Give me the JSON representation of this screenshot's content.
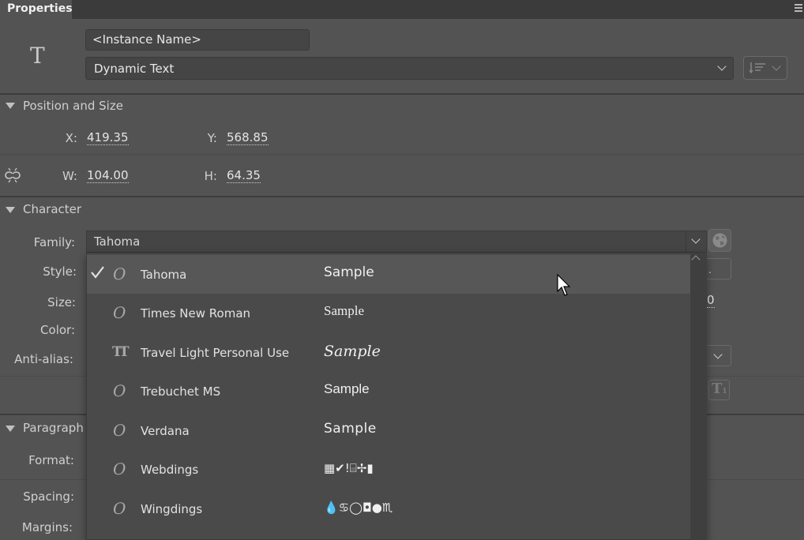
{
  "panel": {
    "tab_label": "Properties",
    "type_icon_glyph": "T",
    "instance_name": "<Instance Name>",
    "text_kind": "Dynamic Text"
  },
  "position_size": {
    "header": "Position and Size",
    "x_label": "X:",
    "x_value": "419.35",
    "y_label": "Y:",
    "y_value": "568.85",
    "w_label": "W:",
    "w_value": "104.00",
    "h_label": "H:",
    "h_value": "64.35"
  },
  "character": {
    "header": "Character",
    "family_label": "Family:",
    "family_value": "Tahoma",
    "style_label": "Style:",
    "size_label": "Size:",
    "size_value_peek": "0",
    "color_label": "Color:",
    "antialias_label": "Anti-alias:",
    "style_value_peek": "."
  },
  "paragraph": {
    "header": "Paragraph",
    "format_label": "Format:",
    "spacing_label": "Spacing:",
    "margins_label": "Margins:"
  },
  "font_dropdown": {
    "items": [
      {
        "name": "Tahoma",
        "sample": "Sample",
        "icon": "opentype-icon",
        "icon_glyph": "O",
        "selected": true
      },
      {
        "name": "Times New Roman",
        "sample": "Sample",
        "icon": "opentype-icon",
        "icon_glyph": "O",
        "selected": false
      },
      {
        "name": "Travel Light Personal Use",
        "sample": "Sample",
        "icon": "truetype-icon",
        "icon_glyph": "TT",
        "selected": false
      },
      {
        "name": "Trebuchet MS",
        "sample": "Sample",
        "icon": "opentype-icon",
        "icon_glyph": "O",
        "selected": false
      },
      {
        "name": "Verdana",
        "sample": "Sample",
        "icon": "opentype-icon",
        "icon_glyph": "O",
        "selected": false
      },
      {
        "name": "Webdings",
        "sample": "▦✔!⌸✢▮",
        "icon": "opentype-icon",
        "icon_glyph": "O",
        "selected": false
      },
      {
        "name": "Wingdings",
        "sample": "💧♋◯◘●♏",
        "icon": "opentype-icon",
        "icon_glyph": "O",
        "selected": false
      }
    ]
  },
  "colors": {
    "panel_bg": "#535353",
    "tab_bar_bg": "#3b3b3b",
    "field_bg": "#454545",
    "dropdown_bg": "#4a4a4a",
    "selected_row_bg": "#575757"
  }
}
